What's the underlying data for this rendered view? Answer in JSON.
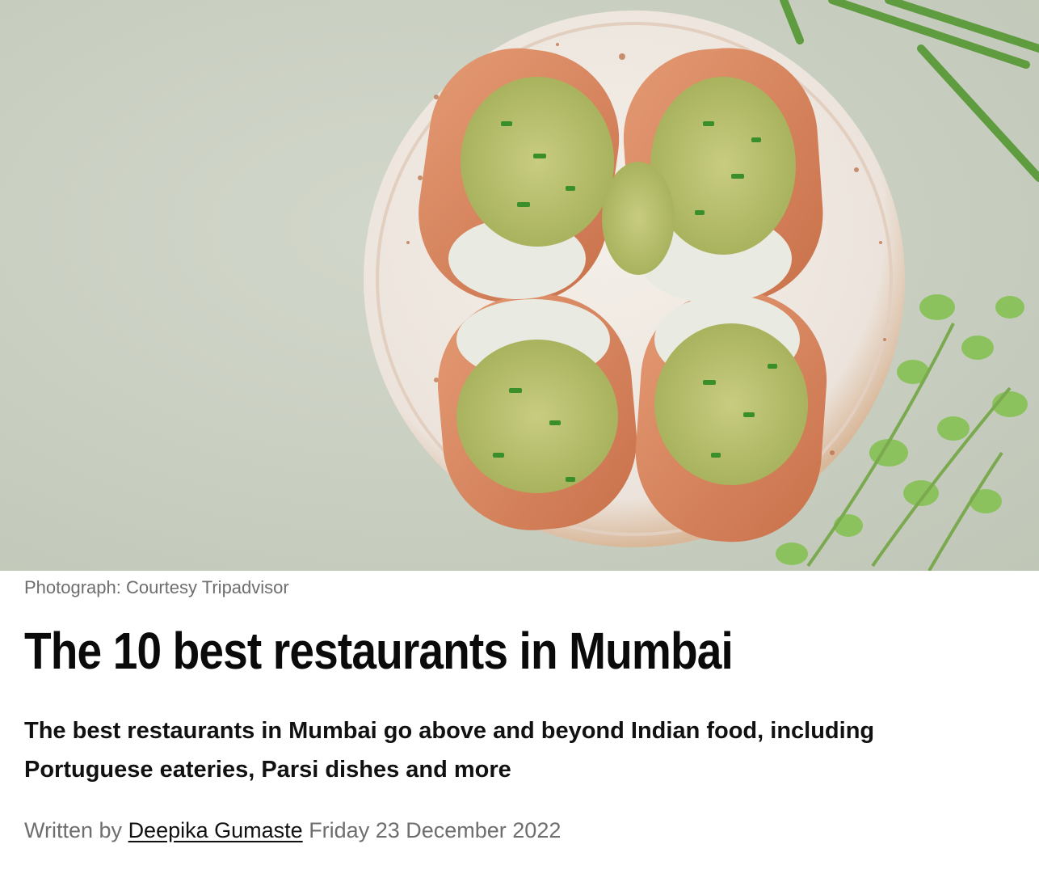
{
  "hero_image": {
    "alt": "Plate of stuffed bread rolls topped with green chutney and chives",
    "caption": "Photograph: Courtesy Tripadvisor"
  },
  "article": {
    "title": "The 10 best restaurants in Mumbai",
    "standfirst": "The best restaurants in Mumbai go above and beyond Indian food, including Portuguese eateries, Parsi dishes and more",
    "byline": {
      "prefix": "Written by",
      "author": "Deepika Gumaste",
      "date": "Friday 23 December 2022"
    }
  },
  "colors": {
    "hero_background": "#c9cfc1",
    "caption_text": "#6e6e6e",
    "headline_text": "#0a0a0a",
    "link_text": "#111111"
  }
}
